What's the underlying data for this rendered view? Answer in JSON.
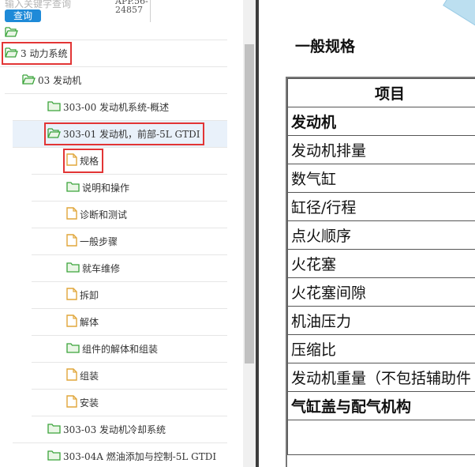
{
  "search": {
    "placeholder": "输入关键字查询",
    "button_label": "查询",
    "app_code": "APP.56-24857"
  },
  "tree": {
    "items": [
      {
        "label": "3 动力系统",
        "icon": "folder-open-icon",
        "depth": 0,
        "highlighted": true
      },
      {
        "label": "03 发动机",
        "icon": "folder-open-icon",
        "depth": 1
      },
      {
        "label": "303-00 发动机系统-概述",
        "icon": "folder-closed-icon",
        "depth": 2
      },
      {
        "label": "303-01 发动机，前部-5L GTDI",
        "icon": "folder-open-icon",
        "depth": 2,
        "selected": true,
        "highlighted": true
      },
      {
        "label": "规格",
        "icon": "document-icon",
        "depth": 3,
        "highlighted": true
      },
      {
        "label": "说明和操作",
        "icon": "folder-closed-icon",
        "depth": 3
      },
      {
        "label": "诊断和测试",
        "icon": "document-icon",
        "depth": 3
      },
      {
        "label": "一般步骤",
        "icon": "document-icon",
        "depth": 3
      },
      {
        "label": "就车维修",
        "icon": "folder-closed-icon",
        "depth": 3
      },
      {
        "label": "拆卸",
        "icon": "document-icon",
        "depth": 3
      },
      {
        "label": "解体",
        "icon": "document-icon",
        "depth": 3
      },
      {
        "label": "组件的解体和组装",
        "icon": "folder-closed-icon",
        "depth": 3
      },
      {
        "label": "组装",
        "icon": "document-icon",
        "depth": 3
      },
      {
        "label": "安装",
        "icon": "document-icon",
        "depth": 3
      },
      {
        "label": "303-03 发动机冷却系统",
        "icon": "folder-closed-icon",
        "depth": 2
      },
      {
        "label": "303-04A 燃油添加与控制-5L GTDI",
        "icon": "folder-closed-icon",
        "depth": 2
      }
    ]
  },
  "content": {
    "title": "一般规格",
    "table": {
      "header": "项目",
      "rows": [
        {
          "label": "发动机",
          "bold": true
        },
        {
          "label": "发动机排量"
        },
        {
          "label": "数气缸"
        },
        {
          "label": "缸径/行程"
        },
        {
          "label": "点火顺序"
        },
        {
          "label": "火花塞"
        },
        {
          "label": "火花塞间隙"
        },
        {
          "label": "机油压力"
        },
        {
          "label": "压缩比"
        },
        {
          "label": "发动机重量（不包括辅助件"
        },
        {
          "label": "气缸盖与配气机构",
          "bold": true
        },
        {
          "label": ""
        }
      ]
    }
  },
  "colors": {
    "accent": "#1e8ad8",
    "highlight_box": "#e23535",
    "folder_icon": "#3aa33a",
    "document_icon": "#e0a63a",
    "selected_row_bg": "#e9f1fa"
  }
}
